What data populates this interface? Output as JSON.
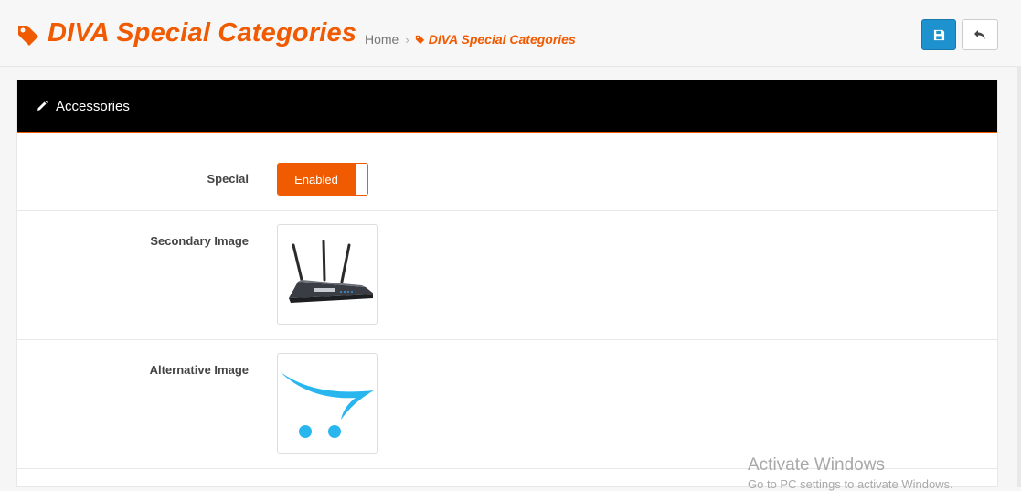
{
  "header": {
    "title": "DIVA Special Categories",
    "title_icon": "tag-icon",
    "breadcrumb": {
      "home": "Home",
      "separator": "›",
      "current": "DIVA Special Categories"
    },
    "buttons": {
      "save_icon": "save-icon",
      "back_icon": "reply-icon"
    }
  },
  "panel": {
    "icon": "pencil-icon",
    "title": "Accessories"
  },
  "form": {
    "special": {
      "label": "Special",
      "value": "Enabled"
    },
    "secondary_image": {
      "label": "Secondary Image",
      "image": "router-image"
    },
    "alternative_image": {
      "label": "Alternative Image",
      "image": "opencart-logo-image"
    }
  },
  "watermark": {
    "title": "Activate Windows",
    "subtitle": "Go to PC settings to activate Windows."
  },
  "colors": {
    "accent": "#f05a00",
    "primary_button": "#1e91cf",
    "heading_bg": "#000000",
    "logo_blue": "#29b6ef"
  }
}
